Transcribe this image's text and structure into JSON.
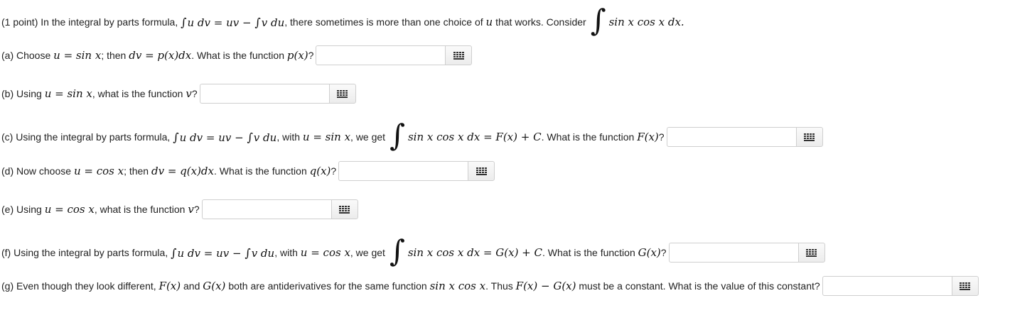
{
  "intro": {
    "prefix": "(1 point) In the integral by parts formula,",
    "formula_lhs": "u dv",
    "eq": "=",
    "formula_uv": "uv",
    "minus": "−",
    "formula_rhs": "v du",
    "mid": ", there sometimes is more than one choice of",
    "u_var": "u",
    "tail": "that works. Consider",
    "integrand": "sin x  cos x dx."
  },
  "part_a": {
    "prefix": "(a) Choose",
    "math1": "u = sin x",
    "mid": "; then",
    "math2": "dv = p(x)dx",
    "mid2": ". What is the function",
    "math3": "p(x)",
    "suffix": "?"
  },
  "part_b": {
    "prefix": "(b) Using",
    "math1": "u = sin x",
    "mid": ", what is the function",
    "math2": "v",
    "suffix": "?"
  },
  "part_c": {
    "prefix": "(c) Using the integral by parts formula,",
    "formula_lhs": "u dv",
    "formula_uv": "= uv −",
    "formula_rhs": "v du",
    "mid": ", with",
    "math1": "u = sin x",
    "mid2": ", we get",
    "integrand": "sin x  cos x dx = F(x) + C",
    "mid3": ". What is the function",
    "math2": "F(x)",
    "suffix": "?"
  },
  "part_d": {
    "prefix": "(d) Now choose",
    "math1": "u = cos x",
    "mid": "; then",
    "math2": "dv = q(x)dx",
    "mid2": ". What is the function",
    "math3": "q(x)",
    "suffix": "?"
  },
  "part_e": {
    "prefix": "(e) Using",
    "math1": "u = cos x",
    "mid": ", what is the function",
    "math2": "v",
    "suffix": "?"
  },
  "part_f": {
    "prefix": "(f) Using the integral by parts formula,",
    "formula_lhs": "u dv",
    "formula_uv": "= uv −",
    "formula_rhs": "v du",
    "mid": ", with",
    "math1": "u = cos x",
    "mid2": ", we get",
    "integrand": "sin x  cos x dx = G(x) + C",
    "mid3": ". What is the function",
    "math2": "G(x)",
    "suffix": "?"
  },
  "part_g": {
    "prefix": "(g) Even though they look different,",
    "math1": "F(x)",
    "and": "and",
    "math2": "G(x)",
    "mid": "both are antiderivatives for the same function",
    "math3": "sin x  cos x",
    "mid2": ". Thus",
    "math4": "F(x) − G(x)",
    "suffix": "must be a constant. What is the value of this constant?"
  },
  "inputs": {
    "a": "",
    "b": "",
    "c": "",
    "d": "",
    "e": "",
    "f": "",
    "g": ""
  },
  "icons": {
    "equation_editor": "keypad-icon"
  }
}
